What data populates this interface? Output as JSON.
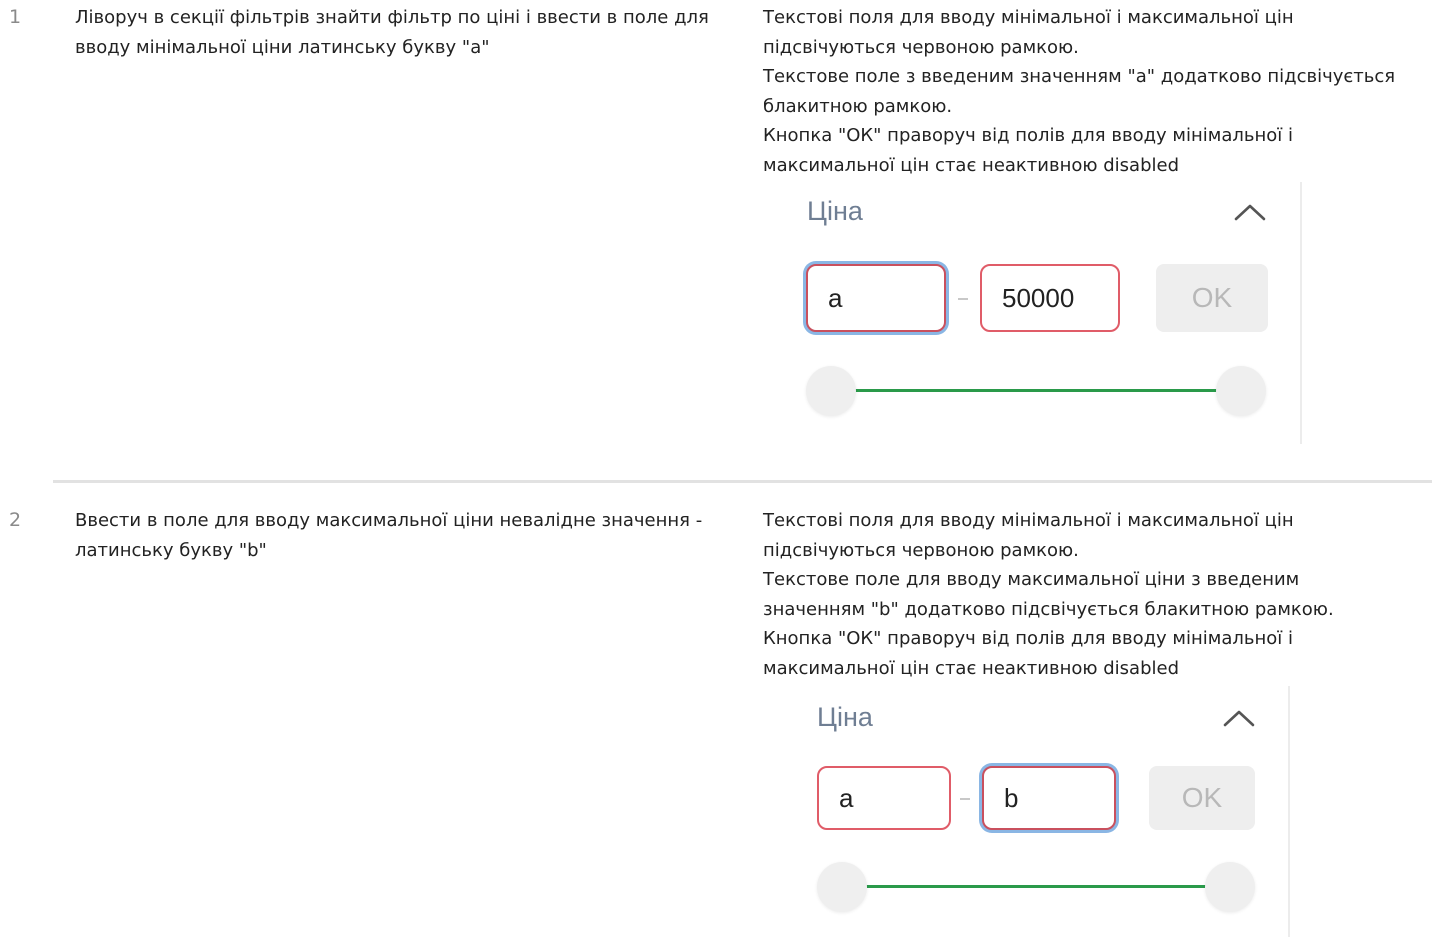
{
  "rows": [
    {
      "number": "1",
      "step": "Ліворуч в секції фільтрів знайти фільтр по ціні і ввести в поле для вводу мінімальної ціни латинську букву \"а\"",
      "expected": "Текстові поля для вводу мінімальної і максимальної цін\nпідсвічуються червоною рамкою.\nТекстове поле з введеним значенням \"а\" додатково підсвічується\nблакитною рамкою.\nКнопка \"ОК\" праворуч від полів для вводу мінімальної і\nмаксимальної цін стає неактивною disabled",
      "widget": {
        "title": "Ціна",
        "min_value": "a",
        "max_value": "50000",
        "ok_label": "OK",
        "focused_field": "min"
      }
    },
    {
      "number": "2",
      "step": "Ввести в поле для вводу максимальної ціни невалідне значення -\nлатинську букву \"b\"",
      "expected": "Текстові поля для вводу мінімальної і максимальної цін\nпідсвічуються червоною рамкою.\nТекстове поле для вводу максимальної ціни з введеним\nзначенням \"b\" додатково підсвічується блакитною рамкою.\nКнопка \"ОК\" праворуч від полів для вводу мінімальної і\nмаксимальної цін стає неактивною disabled",
      "widget": {
        "title": "Ціна",
        "min_value": "a",
        "max_value": "b",
        "ok_label": "OK",
        "focused_field": "max"
      }
    }
  ],
  "colors": {
    "error_border": "#e05c68",
    "focus_ring": "#8ab6e4",
    "slider_track": "#2a9a4a",
    "disabled_button_bg": "#eeeeee"
  }
}
